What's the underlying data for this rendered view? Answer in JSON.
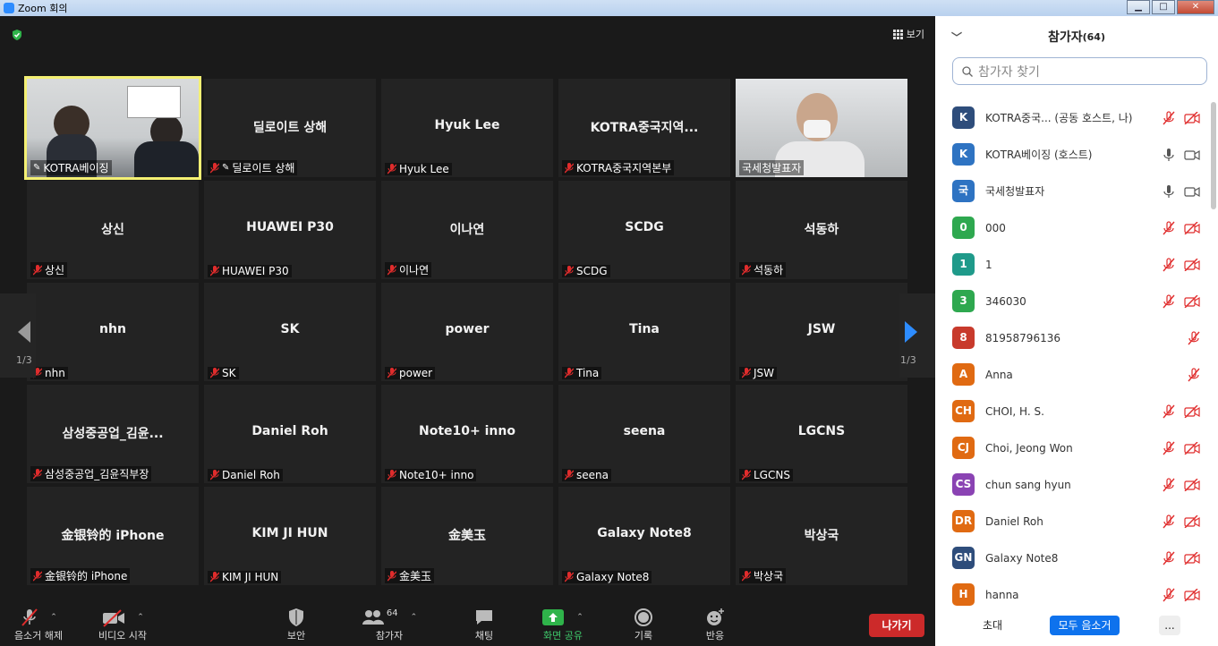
{
  "window": {
    "title": "Zoom 회의",
    "min": "▁",
    "max": "□",
    "close": "✕"
  },
  "top": {
    "view_label": "보기"
  },
  "tiles": [
    {
      "big": "",
      "name": "KOTRA베이징"
    },
    {
      "big": "딜로이트 상해",
      "name": "딜로이트 상해"
    },
    {
      "big": "Hyuk Lee",
      "name": "Hyuk Lee"
    },
    {
      "big": "KOTRA중국지역...",
      "name": "KOTRA중국지역본부"
    },
    {
      "big": "",
      "name": "국세청발표자"
    },
    {
      "big": "상신",
      "name": "상신"
    },
    {
      "big": "HUAWEI P30",
      "name": "HUAWEI P30"
    },
    {
      "big": "이나연",
      "name": "이나연"
    },
    {
      "big": "SCDG",
      "name": "SCDG"
    },
    {
      "big": "석동하",
      "name": "석동하"
    },
    {
      "big": "nhn",
      "name": "nhn"
    },
    {
      "big": "SK",
      "name": "SK"
    },
    {
      "big": "power",
      "name": "power"
    },
    {
      "big": "Tina",
      "name": "Tina"
    },
    {
      "big": "JSW",
      "name": "JSW"
    },
    {
      "big": "삼성중공업_김윤...",
      "name": "삼성중공업_김윤직부장"
    },
    {
      "big": "Daniel Roh",
      "name": "Daniel Roh"
    },
    {
      "big": "Note10+ inno",
      "name": "Note10+ inno"
    },
    {
      "big": "seena",
      "name": "seena"
    },
    {
      "big": "LGCNS",
      "name": "LGCNS"
    },
    {
      "big": "金银铃的 iPhone",
      "name": "金银铃的 iPhone"
    },
    {
      "big": "KIM JI HUN",
      "name": "KIM JI HUN"
    },
    {
      "big": "金美玉",
      "name": "金美玉"
    },
    {
      "big": "Galaxy Note8",
      "name": "Galaxy Note8"
    },
    {
      "big": "박상국",
      "name": "박상국"
    }
  ],
  "paging": {
    "left": "1/3",
    "right": "1/3"
  },
  "toolbar": {
    "mute": "음소거 해제",
    "video": "비디오 시작",
    "security": "보안",
    "participants": "참가자",
    "participants_count": "64",
    "chat": "채팅",
    "share": "화면 공유",
    "record": "기록",
    "reactions": "반응",
    "leave": "나가기"
  },
  "panel": {
    "title": "참가자",
    "count": "(64)",
    "search_placeholder": "참가자 찾기",
    "invite": "초대",
    "mute_all": "모두 음소거",
    "more": "...",
    "participants": [
      {
        "initial": "K",
        "color": "#2e4d7b",
        "name": "KOTRA중국... (공동 호스트, 나)",
        "mic": "muted",
        "video": "off"
      },
      {
        "initial": "K",
        "color": "#2e73c2",
        "name": "KOTRA베이징 (호스트)",
        "mic": "on",
        "video": "on"
      },
      {
        "initial": "국",
        "color": "#2e73c2",
        "name": "국세청발표자",
        "mic": "on",
        "video": "on"
      },
      {
        "initial": "0",
        "color": "#2ea84f",
        "name": "000",
        "mic": "muted",
        "video": "off"
      },
      {
        "initial": "1",
        "color": "#1f9a8a",
        "name": "1",
        "mic": "muted",
        "video": "off"
      },
      {
        "initial": "3",
        "color": "#2ea84f",
        "name": "346030",
        "mic": "muted",
        "video": "off"
      },
      {
        "initial": "8",
        "color": "#c83a2c",
        "name": "81958796136",
        "mic": "muted",
        "video": ""
      },
      {
        "initial": "A",
        "color": "#e06a12",
        "name": "Anna",
        "mic": "muted",
        "video": ""
      },
      {
        "initial": "CH",
        "color": "#e06a12",
        "name": "CHOI, H. S.",
        "mic": "muted",
        "video": "off"
      },
      {
        "initial": "CJ",
        "color": "#e06a12",
        "name": "Choi, Jeong Won",
        "mic": "muted",
        "video": "off"
      },
      {
        "initial": "CS",
        "color": "#8a43b3",
        "name": "chun sang hyun",
        "mic": "muted",
        "video": "off"
      },
      {
        "initial": "DR",
        "color": "#e06a12",
        "name": "Daniel Roh",
        "mic": "muted",
        "video": "off"
      },
      {
        "initial": "GN",
        "color": "#2e4d7b",
        "name": "Galaxy Note8",
        "mic": "muted",
        "video": "off"
      },
      {
        "initial": "H",
        "color": "#e06a12",
        "name": "hanna",
        "mic": "muted",
        "video": "off"
      }
    ]
  }
}
